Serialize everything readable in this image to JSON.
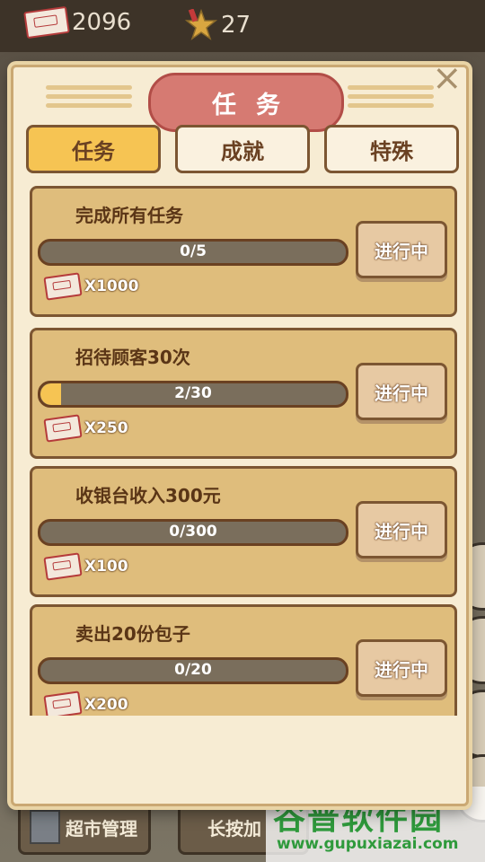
{
  "hud": {
    "tickets": "2096",
    "stars": "27"
  },
  "dialog": {
    "title": "任务",
    "tabs": [
      "任务",
      "成就",
      "特殊"
    ],
    "active_tab": 0
  },
  "tasks": [
    {
      "name": "完成所有任务",
      "progress_text": "0/5",
      "progress": 0.0,
      "reward": "X1000",
      "status": "进行中"
    },
    {
      "name": "招待顾客30次",
      "progress_text": "2/30",
      "progress": 0.067,
      "reward": "X250",
      "status": "进行中"
    },
    {
      "name": "收银台收入300元",
      "progress_text": "0/300",
      "progress": 0.0,
      "reward": "X100",
      "status": "进行中"
    },
    {
      "name": "卖出20份包子",
      "progress_text": "0/20",
      "progress": 0.0,
      "reward": "X200",
      "status": "进行中"
    }
  ],
  "bottom": {
    "market_label": "超市管理",
    "boost_label": "长按加"
  },
  "watermark": {
    "title": "谷普软件园",
    "url": "www.gupuxiazai.com"
  },
  "colors": {
    "accent": "#f6c453",
    "card": "#dfbd7c",
    "title_badge": "#d67a72",
    "border": "#7c5632"
  }
}
